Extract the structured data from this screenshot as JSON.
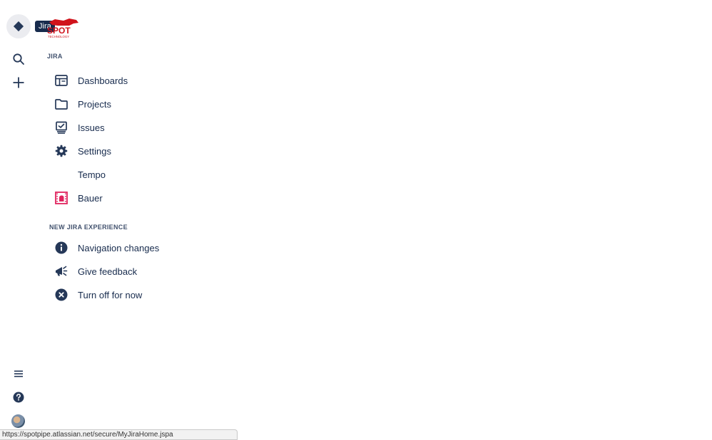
{
  "global_nav": {
    "product_tooltip": "Jira",
    "icons": {
      "product": "jira-diamond-icon",
      "search": "search-icon",
      "create": "plus-icon",
      "menu": "hamburger-icon",
      "help": "help-icon",
      "profile": "avatar"
    }
  },
  "brand": {
    "name": "SPOT",
    "tagline": "TECHNOLOGY",
    "color": "#d0121b"
  },
  "sections": {
    "jira_title": "JIRA",
    "experience_title": "NEW JIRA EXPERIENCE"
  },
  "jira_items": [
    {
      "label": "Dashboards",
      "icon": "dashboard-icon"
    },
    {
      "label": "Projects",
      "icon": "folder-icon"
    },
    {
      "label": "Issues",
      "icon": "issues-icon"
    },
    {
      "label": "Settings",
      "icon": "gear-icon"
    },
    {
      "label": "Tempo",
      "icon": ""
    },
    {
      "label": "Bauer",
      "icon": "bauer-app-icon"
    }
  ],
  "experience_items": [
    {
      "label": "Navigation changes",
      "icon": "info-icon"
    },
    {
      "label": "Give feedback",
      "icon": "megaphone-icon"
    },
    {
      "label": "Turn off for now",
      "icon": "close-circle-icon"
    }
  ],
  "status_bar": {
    "url": "https://spotpipe.atlassian.net/secure/MyJiraHome.jspa"
  },
  "colors": {
    "text": "#172b4d",
    "icon": "#42526e",
    "tooltip_bg": "#172b4d",
    "brand_red": "#d0121b",
    "bauer_pink": "#e0245e"
  }
}
